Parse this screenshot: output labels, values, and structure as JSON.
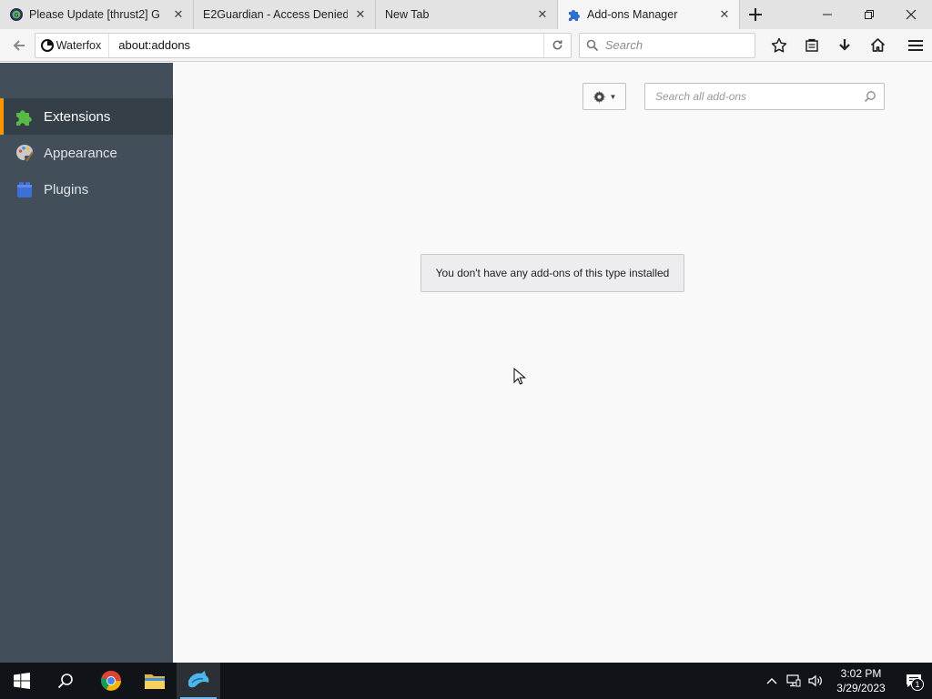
{
  "tabs": [
    {
      "title": "Please Update [thrust2] G",
      "icon": "gamefaqs-favicon",
      "active": false
    },
    {
      "title": "E2Guardian - Access Denied",
      "icon": "",
      "active": false
    },
    {
      "title": "New Tab",
      "icon": "",
      "active": false
    },
    {
      "title": "Add-ons Manager",
      "icon": "puzzle-piece-icon",
      "active": true
    }
  ],
  "navbar": {
    "identity_label": "Waterfox",
    "url": "about:addons",
    "search_placeholder": "Search"
  },
  "sidebar": {
    "categories": [
      {
        "label": "Extensions",
        "icon": "puzzle-piece-icon",
        "selected": true
      },
      {
        "label": "Appearance",
        "icon": "paint-palette-icon",
        "selected": false
      },
      {
        "label": "Plugins",
        "icon": "lego-brick-icon",
        "selected": false
      }
    ]
  },
  "main": {
    "addon_search_placeholder": "Search all add-ons",
    "empty_message": "You don't have any add-ons of this type installed"
  },
  "taskbar": {
    "time": "3:02 PM",
    "date": "3/29/2023",
    "notification_count": "1"
  },
  "colors": {
    "sidebar_bg": "#424f5a",
    "sidebar_selected_bg": "#343f48",
    "selection_accent": "#ff9500",
    "content_bg": "#f9f9fa",
    "taskbar_bg": "#101418"
  }
}
